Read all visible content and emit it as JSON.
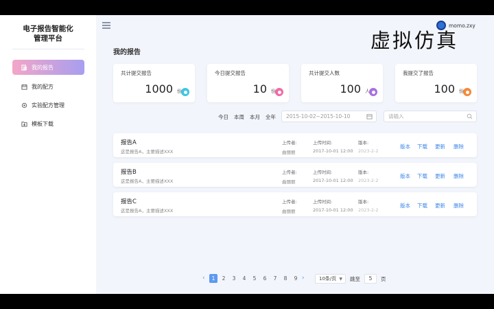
{
  "sidebar": {
    "brand_line1": "电子报告智能化",
    "brand_line2": "管理平台",
    "items": [
      {
        "label": "我的报告",
        "icon": "report-icon",
        "active": true
      },
      {
        "label": "我的配方",
        "icon": "calendar-icon",
        "active": false
      },
      {
        "label": "实验配方管理",
        "icon": "gear-icon",
        "active": false
      },
      {
        "label": "模板下载",
        "icon": "download-folder-icon",
        "active": false
      }
    ]
  },
  "header": {
    "username": "momo.zxy",
    "watermark": "虚拟仿真"
  },
  "page_title": "我的报告",
  "stats": [
    {
      "label": "共计提交报告",
      "value": "1000",
      "unit": "份",
      "color": "#3ec6e0"
    },
    {
      "label": "今日提交报告",
      "value": "10",
      "unit": "份",
      "color": "#f26aa6"
    },
    {
      "label": "共计提交人数",
      "value": "100",
      "unit": "人",
      "color": "#a86fe0"
    },
    {
      "label": "我提交了报告",
      "value": "100",
      "unit": "份",
      "color": "#f5893a"
    }
  ],
  "filters": {
    "today": "今日",
    "week": "本周",
    "month": "本月",
    "year": "全年",
    "date_range": "2015-10-02~2015-10-10",
    "search_placeholder": "请输入"
  },
  "reports": [
    {
      "title": "报告A",
      "desc": "这是报告A，主要描述XXX",
      "uploader_label": "上传者:",
      "uploader": "曲丽丽",
      "time_label": "上传时间:",
      "time": "2017-10-01  12:00",
      "version_label": "版本:",
      "version": "2023-2-2"
    },
    {
      "title": "报告B",
      "desc": "这是报告A，主要描述XXX",
      "uploader_label": "上传者:",
      "uploader": "曲丽丽",
      "time_label": "上传时间:",
      "time": "2017-10-01  12:00",
      "version_label": "版本:",
      "version": "2023-2-2"
    },
    {
      "title": "报告C",
      "desc": "这是报告A，主要描述XXX",
      "uploader_label": "上传者:",
      "uploader": "曲丽丽",
      "time_label": "上传时间:",
      "time": "2017-10-01  12:00",
      "version_label": "版本:",
      "version": "2023-2-2"
    }
  ],
  "row_actions": {
    "version": "版本",
    "download": "下载",
    "update": "更新",
    "delete": "删除"
  },
  "pagination": {
    "prev": "‹",
    "next": "›",
    "pages": [
      "1",
      "2",
      "3",
      "4",
      "5",
      "6",
      "7",
      "8",
      "9"
    ],
    "current": "1",
    "page_size": "10条/页",
    "goto_label": "跳至",
    "goto_value": "5",
    "goto_suffix": "页"
  }
}
